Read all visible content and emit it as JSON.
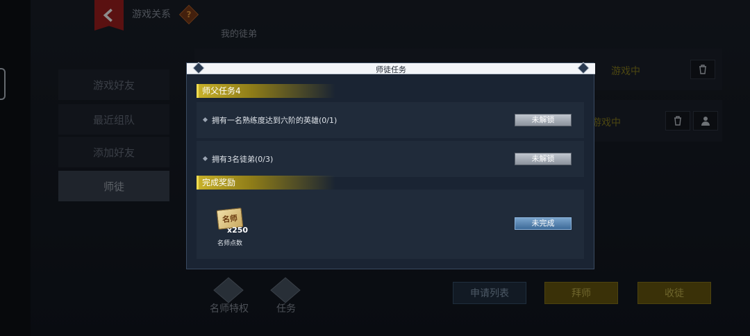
{
  "header": {
    "title": "游戏关系",
    "help_icon": "?"
  },
  "sidebar": {
    "items": [
      {
        "label": "游戏好友"
      },
      {
        "label": "最近组队"
      },
      {
        "label": "添加好友"
      },
      {
        "label": "师徒"
      }
    ]
  },
  "main": {
    "section_label": "我的徒弟",
    "rows": [
      {
        "status": "游戏中"
      },
      {
        "status": "游戏中"
      }
    ]
  },
  "bottom": {
    "icon_labels": [
      "名师特权",
      "任务"
    ],
    "buttons": {
      "apply_list": "申请列表",
      "become_apprentice": "拜师",
      "take_disciple": "收徒"
    }
  },
  "modal": {
    "title": "师徒任务",
    "task_section_title": "师父任务4",
    "tasks": [
      {
        "text": "拥有一名熟练度达到六阶的英雄(0/1)",
        "button": "未解锁"
      },
      {
        "text": "拥有3名徒弟(0/3)",
        "button": "未解锁"
      }
    ],
    "reward_section_title": "完成奖励",
    "reward": {
      "icon_text": "名师",
      "count": "x250",
      "name": "名师点数",
      "button": "未完成"
    }
  }
}
